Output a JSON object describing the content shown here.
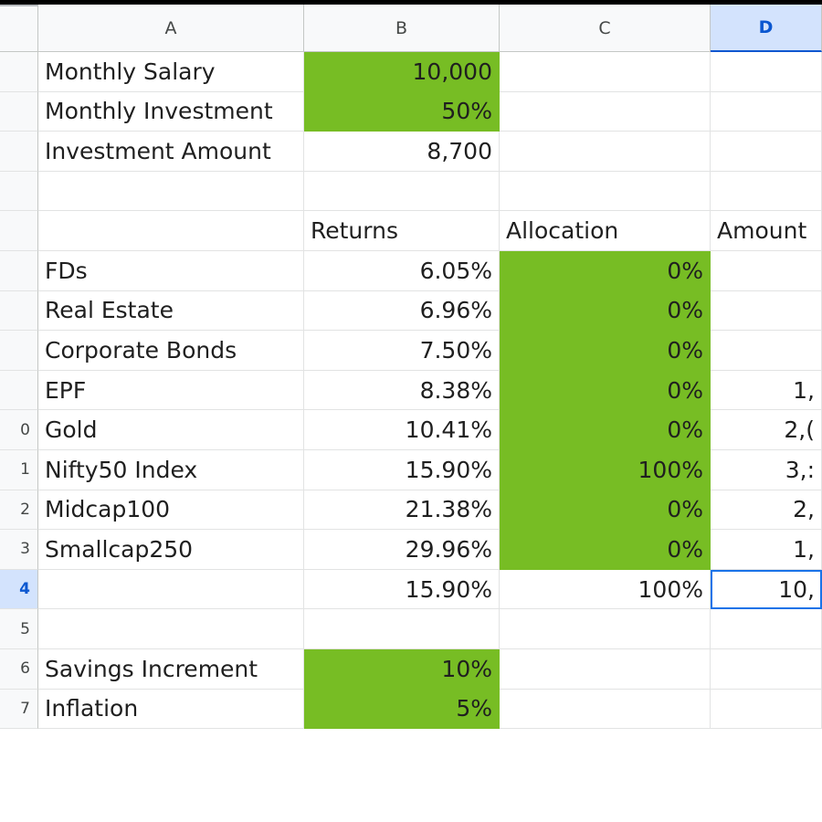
{
  "columns": [
    "A",
    "B",
    "C",
    "D"
  ],
  "selected_column": "D",
  "row_numbers": [
    "",
    "",
    "",
    "",
    "",
    "",
    "",
    "",
    "0",
    "1",
    "2",
    "3",
    "4",
    "5",
    "6",
    "7"
  ],
  "rows": [
    {
      "a": "Monthly Salary",
      "b": "10,000",
      "c": "",
      "d": ""
    },
    {
      "a": "Monthly Investment",
      "b": "50%",
      "c": "",
      "d": ""
    },
    {
      "a": "Investment Amount",
      "b": "8,700",
      "c": "",
      "d": ""
    },
    {
      "a": "",
      "b": "",
      "c": "",
      "d": ""
    },
    {
      "a": "",
      "b": "Returns",
      "c": "Allocation",
      "d": "Amount"
    },
    {
      "a": "FDs",
      "b": "6.05%",
      "c": "0%",
      "d": ""
    },
    {
      "a": "Real Estate",
      "b": "6.96%",
      "c": "0%",
      "d": ""
    },
    {
      "a": "Corporate Bonds",
      "b": "7.50%",
      "c": "0%",
      "d": ""
    },
    {
      "a": "EPF",
      "b": "8.38%",
      "c": "0%",
      "d": "1,"
    },
    {
      "a": "Gold",
      "b": "10.41%",
      "c": "0%",
      "d": "2,("
    },
    {
      "a": "Nifty50 Index",
      "b": "15.90%",
      "c": "100%",
      "d": "3,:"
    },
    {
      "a": "Midcap100",
      "b": "21.38%",
      "c": "0%",
      "d": "2,"
    },
    {
      "a": "Smallcap250",
      "b": "29.96%",
      "c": "0%",
      "d": "1,"
    },
    {
      "a": "",
      "b": "15.90%",
      "c": "100%",
      "d": "10,"
    },
    {
      "a": "",
      "b": "",
      "c": "",
      "d": ""
    },
    {
      "a": "Savings Increment",
      "b": "10%",
      "c": "",
      "d": ""
    },
    {
      "a": "Inflation",
      "b": "5%",
      "c": "",
      "d": ""
    }
  ],
  "colors": {
    "input_fill": "#77bd24",
    "selection": "#1a73e8",
    "header_bg": "#f8f9fa"
  }
}
